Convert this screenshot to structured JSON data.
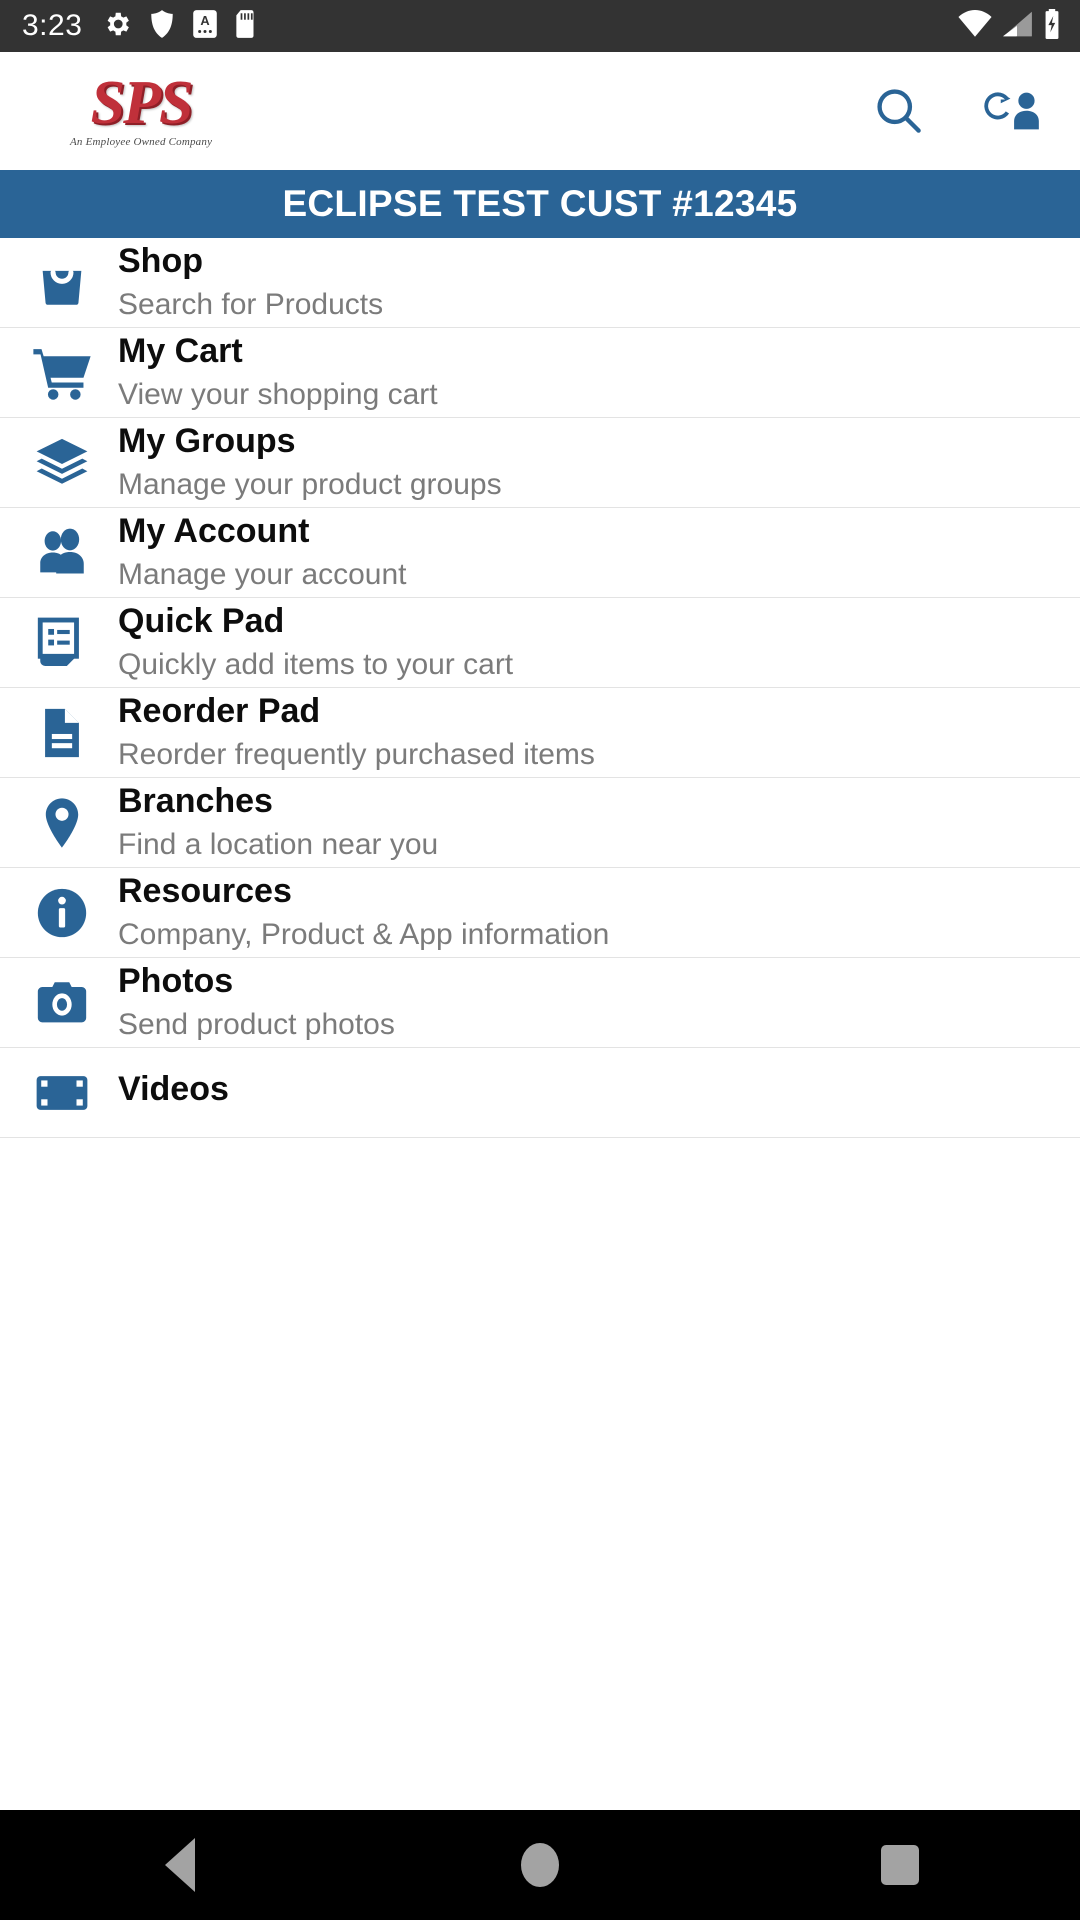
{
  "status_bar": {
    "clock": "3:23",
    "left_icons": [
      "gear-icon",
      "shield-icon",
      "a-badge-icon",
      "sd-card-icon"
    ],
    "right_icons": [
      "wifi-icon",
      "cell-signal-icon",
      "battery-charging-icon"
    ]
  },
  "app_bar": {
    "logo_text": "SPS",
    "logo_tagline": "An Employee Owned Company",
    "actions": [
      {
        "name": "search-icon",
        "label": "Search"
      },
      {
        "name": "switch-user-icon",
        "label": "Switch User"
      }
    ]
  },
  "banner": {
    "text": "ECLIPSE TEST CUST #12345"
  },
  "menu": {
    "items": [
      {
        "icon": "shopping-bag-icon",
        "title": "Shop",
        "subtitle": "Search for Products"
      },
      {
        "icon": "shopping-cart-icon",
        "title": "My Cart",
        "subtitle": "View your shopping cart"
      },
      {
        "icon": "layers-icon",
        "title": "My Groups",
        "subtitle": "Manage your product groups"
      },
      {
        "icon": "people-icon",
        "title": "My Account",
        "subtitle": "Manage your account"
      },
      {
        "icon": "list-note-icon",
        "title": "Quick Pad",
        "subtitle": "Quickly add items to your cart"
      },
      {
        "icon": "document-icon",
        "title": "Reorder Pad",
        "subtitle": "Reorder frequently purchased items"
      },
      {
        "icon": "map-pin-icon",
        "title": "Branches",
        "subtitle": "Find a location near you"
      },
      {
        "icon": "info-circle-icon",
        "title": "Resources",
        "subtitle": "Company, Product & App information"
      },
      {
        "icon": "camera-icon",
        "title": "Photos",
        "subtitle": "Send product photos"
      },
      {
        "icon": "film-icon",
        "title": "Videos",
        "subtitle": ""
      }
    ]
  },
  "nav_bar": {
    "buttons": [
      {
        "name": "back-button",
        "label": "Back"
      },
      {
        "name": "home-button",
        "label": "Home"
      },
      {
        "name": "recents-button",
        "label": "Recents"
      }
    ]
  },
  "colors": {
    "accent_blue": "#2a6496",
    "logo_red": "#c0303a",
    "status_bar": "#333333",
    "subtitle_gray": "#7b7b7b"
  }
}
